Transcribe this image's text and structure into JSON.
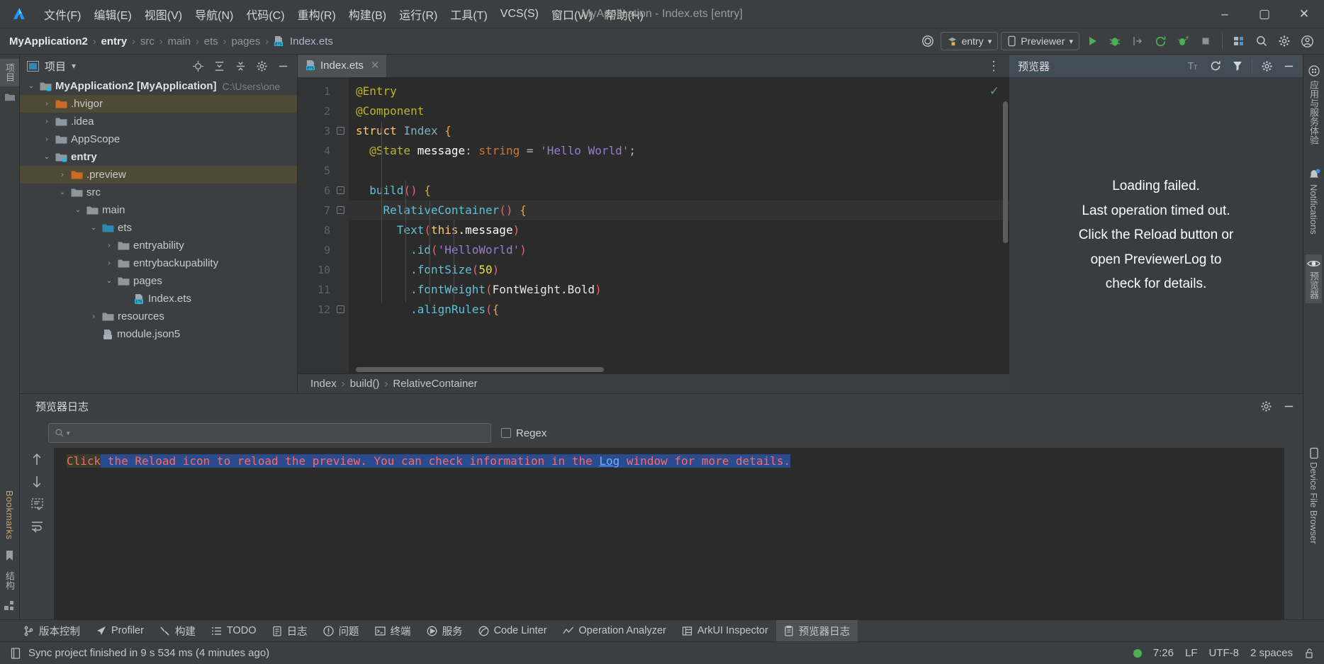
{
  "titlebar": {
    "app_logo": "deveco-logo-icon",
    "menus": [
      {
        "label": "文件(F)",
        "name": "menu-file"
      },
      {
        "label": "编辑(E)",
        "name": "menu-edit"
      },
      {
        "label": "视图(V)",
        "name": "menu-view"
      },
      {
        "label": "导航(N)",
        "name": "menu-navigate"
      },
      {
        "label": "代码(C)",
        "name": "menu-code"
      },
      {
        "label": "重构(R)",
        "name": "menu-refactor"
      },
      {
        "label": "构建(B)",
        "name": "menu-build"
      },
      {
        "label": "运行(R)",
        "name": "menu-run"
      },
      {
        "label": "工具(T)",
        "name": "menu-tools"
      },
      {
        "label": "VCS(S)",
        "name": "menu-vcs"
      },
      {
        "label": "窗口(W)",
        "name": "menu-window"
      },
      {
        "label": "帮助(H)",
        "name": "menu-help"
      }
    ],
    "window_title": "MyApplication - Index.ets [entry]",
    "minimize": "–",
    "maximize": "▢",
    "close": "✕"
  },
  "navbar": {
    "breadcrumbs": [
      "MyApplication2",
      "entry",
      "src",
      "main",
      "ets",
      "pages",
      "Index.ets"
    ],
    "separator": "›",
    "run_config": "entry",
    "device_target": "Previewer",
    "dropdown_caret": "▾",
    "buttons": {
      "device_manager": "device-manager-icon",
      "run": "run-icon",
      "debug": "debug-icon",
      "attach": "attach-debugger-icon",
      "reload": "hot-reload-icon",
      "profile": "profile-icon",
      "stop": "stop-icon",
      "project_structure": "project-structure-icon",
      "search": "search-everywhere-icon",
      "settings": "settings-icon",
      "account": "account-icon"
    }
  },
  "left_strip": {
    "tabs": [
      {
        "label": "项目",
        "name": "left-tab-project",
        "active": true
      },
      {
        "label": "",
        "name": "left-tab-folder-icon",
        "active": false
      }
    ],
    "bottom_tabs": [
      {
        "label": "Bookmarks",
        "name": "left-tab-bookmarks"
      },
      {
        "label": "结构",
        "name": "left-tab-structure"
      }
    ]
  },
  "project_panel": {
    "title": "项目",
    "title_caret": "▾",
    "header_buttons": [
      "select-opened-file-icon",
      "expand-all-icon",
      "collapse-all-icon",
      "settings-icon",
      "hide-icon"
    ],
    "tree": [
      {
        "indent": 0,
        "arrow": "v",
        "icon": "module-folder",
        "label": "MyApplication2 [MyApplication]",
        "bold": true,
        "path": "C:\\Users\\one",
        "state": "normal"
      },
      {
        "indent": 1,
        "arrow": ">",
        "icon": "excluded-folder",
        "label": ".hvigor",
        "bold": false,
        "path": "",
        "state": "highlight"
      },
      {
        "indent": 1,
        "arrow": ">",
        "icon": "folder",
        "label": ".idea",
        "bold": false,
        "path": "",
        "state": "normal"
      },
      {
        "indent": 1,
        "arrow": ">",
        "icon": "folder",
        "label": "AppScope",
        "bold": false,
        "path": "",
        "state": "normal"
      },
      {
        "indent": 1,
        "arrow": "v",
        "icon": "module-folder",
        "label": "entry",
        "bold": true,
        "path": "",
        "state": "normal"
      },
      {
        "indent": 2,
        "arrow": ">",
        "icon": "excluded-folder",
        "label": ".preview",
        "bold": false,
        "path": "",
        "state": "highlight"
      },
      {
        "indent": 2,
        "arrow": "v",
        "icon": "folder",
        "label": "src",
        "bold": false,
        "path": "",
        "state": "normal"
      },
      {
        "indent": 3,
        "arrow": "v",
        "icon": "folder",
        "label": "main",
        "bold": false,
        "path": "",
        "state": "normal"
      },
      {
        "indent": 4,
        "arrow": "v",
        "icon": "source-folder",
        "label": "ets",
        "bold": false,
        "path": "",
        "state": "normal"
      },
      {
        "indent": 5,
        "arrow": ">",
        "icon": "folder",
        "label": "entryability",
        "bold": false,
        "path": "",
        "state": "normal"
      },
      {
        "indent": 5,
        "arrow": ">",
        "icon": "folder",
        "label": "entrybackupability",
        "bold": false,
        "path": "",
        "state": "normal"
      },
      {
        "indent": 5,
        "arrow": "v",
        "icon": "folder",
        "label": "pages",
        "bold": false,
        "path": "",
        "state": "normal"
      },
      {
        "indent": 6,
        "arrow": "",
        "icon": "ets-file",
        "label": "Index.ets",
        "bold": false,
        "path": "",
        "state": "normal"
      },
      {
        "indent": 4,
        "arrow": ">",
        "icon": "folder",
        "label": "resources",
        "bold": false,
        "path": "",
        "state": "normal"
      },
      {
        "indent": 4,
        "arrow": "",
        "icon": "json-file",
        "label": "module.json5",
        "bold": false,
        "path": "",
        "state": "normal"
      }
    ]
  },
  "editor": {
    "tab": {
      "label": "Index.ets",
      "icon": "ets-file-icon",
      "close": "✕"
    },
    "more_button": "⋮",
    "inspection_status": "✓",
    "lines": [
      {
        "n": "1",
        "fold": "",
        "tokens": [
          {
            "t": "@Entry",
            "c": "deco"
          }
        ]
      },
      {
        "n": "2",
        "fold": "",
        "tokens": [
          {
            "t": "@Component",
            "c": "deco"
          }
        ]
      },
      {
        "n": "3",
        "fold": "-",
        "tokens": [
          {
            "t": "struct",
            "c": "kwb"
          },
          {
            "t": " ",
            "c": "plain"
          },
          {
            "t": "Index",
            "c": "teal"
          },
          {
            "t": " ",
            "c": "plain"
          },
          {
            "t": "{",
            "c": "brace"
          }
        ]
      },
      {
        "n": "4",
        "fold": "",
        "tokens": [
          {
            "t": "  ",
            "c": "plain"
          },
          {
            "t": "@State",
            "c": "deco"
          },
          {
            "t": " ",
            "c": "plain"
          },
          {
            "t": "message",
            "c": "wh"
          },
          {
            "t": ":",
            "c": "plain"
          },
          {
            "t": " ",
            "c": "plain"
          },
          {
            "t": "string",
            "c": "kw"
          },
          {
            "t": " ",
            "c": "plain"
          },
          {
            "t": "=",
            "c": "plain"
          },
          {
            "t": " ",
            "c": "plain"
          },
          {
            "t": "'Hello World'",
            "c": "purp"
          },
          {
            "t": ";",
            "c": "plain"
          }
        ]
      },
      {
        "n": "5",
        "fold": "",
        "tokens": []
      },
      {
        "n": "6",
        "fold": "-",
        "tokens": [
          {
            "t": "  ",
            "c": "plain"
          },
          {
            "t": "build",
            "c": "cyan"
          },
          {
            "t": "()",
            "c": "paren"
          },
          {
            "t": " ",
            "c": "plain"
          },
          {
            "t": "{",
            "c": "brace"
          }
        ]
      },
      {
        "n": "7",
        "fold": "-",
        "tokens": [
          {
            "t": "    ",
            "c": "plain"
          },
          {
            "t": "RelativeContainer",
            "c": "cyan"
          },
          {
            "t": "()",
            "c": "paren"
          },
          {
            "t": " ",
            "c": "plain"
          },
          {
            "t": "{",
            "c": "brace"
          }
        ]
      },
      {
        "n": "8",
        "fold": "",
        "tokens": [
          {
            "t": "      ",
            "c": "plain"
          },
          {
            "t": "Text",
            "c": "cyan"
          },
          {
            "t": "(",
            "c": "paren"
          },
          {
            "t": "this",
            "c": "kwb"
          },
          {
            "t": ".",
            "c": "wh"
          },
          {
            "t": "message",
            "c": "wh"
          },
          {
            "t": ")",
            "c": "paren"
          }
        ]
      },
      {
        "n": "9",
        "fold": "",
        "tokens": [
          {
            "t": "        ",
            "c": "plain"
          },
          {
            "t": ".",
            "c": "cyan"
          },
          {
            "t": "id",
            "c": "cyan"
          },
          {
            "t": "(",
            "c": "paren"
          },
          {
            "t": "'HelloWorld'",
            "c": "purp"
          },
          {
            "t": ")",
            "c": "paren"
          }
        ]
      },
      {
        "n": "10",
        "fold": "",
        "tokens": [
          {
            "t": "        ",
            "c": "plain"
          },
          {
            "t": ".",
            "c": "cyan"
          },
          {
            "t": "fontSize",
            "c": "cyan"
          },
          {
            "t": "(",
            "c": "paren"
          },
          {
            "t": "50",
            "c": "yel"
          },
          {
            "t": ")",
            "c": "paren"
          }
        ]
      },
      {
        "n": "11",
        "fold": "",
        "tokens": [
          {
            "t": "        ",
            "c": "plain"
          },
          {
            "t": ".",
            "c": "cyan"
          },
          {
            "t": "fontWeight",
            "c": "cyan"
          },
          {
            "t": "(",
            "c": "paren"
          },
          {
            "t": "FontWeight",
            "c": "white"
          },
          {
            "t": ".",
            "c": "white"
          },
          {
            "t": "Bold",
            "c": "white"
          },
          {
            "t": ")",
            "c": "paren"
          }
        ]
      },
      {
        "n": "12",
        "fold": "-",
        "tokens": [
          {
            "t": "        ",
            "c": "plain"
          },
          {
            "t": ".",
            "c": "cyan"
          },
          {
            "t": "alignRules",
            "c": "cyan"
          },
          {
            "t": "(",
            "c": "paren"
          },
          {
            "t": "{",
            "c": "brace"
          }
        ]
      }
    ],
    "breadcrumb": [
      "Index",
      "build()",
      "RelativeContainer"
    ],
    "breadcrumb_sep": "›"
  },
  "previewer": {
    "title": "预览器",
    "header_buttons": [
      "text-scale-icon",
      "reload-icon",
      "inspector-icon",
      "settings-icon",
      "hide-icon"
    ],
    "message_lines": [
      "Loading failed.",
      "Last operation timed out.",
      "Click the Reload button or",
      "open PreviewerLog to",
      "check for details."
    ]
  },
  "right_strip": {
    "tabs": [
      {
        "label": "应用与服务体验",
        "name": "right-tab-app-services",
        "icon": "app-services-icon",
        "active": false
      },
      {
        "label": "Notifications",
        "name": "right-tab-notifications",
        "icon": "bell-icon",
        "active": false
      },
      {
        "label": "预览器",
        "name": "right-tab-previewer",
        "icon": "eye-icon",
        "active": true
      },
      {
        "label": "Device File Browser",
        "name": "right-tab-device-file-browser",
        "icon": "device-icon",
        "active": false
      }
    ]
  },
  "log_panel": {
    "title": "预览器日志",
    "header_buttons": [
      "settings-icon",
      "hide-icon"
    ],
    "search_placeholder": "",
    "search_value": "",
    "search_icon": "search-icon",
    "regex_label": "Regex",
    "regex_checked": false,
    "side_buttons": [
      "scroll-up-icon",
      "scroll-down-icon",
      "soft-wrap-icon",
      "wrap-lines-icon"
    ],
    "log_line": {
      "prefix": "Click",
      "body": " the Reload icon to reload the preview. You can check information in the ",
      "link": "Log",
      "suffix": " window for more details."
    }
  },
  "tool_window_bar": {
    "items": [
      {
        "label": "版本控制",
        "name": "tw-version-control",
        "icon": "branch-icon",
        "active": false
      },
      {
        "label": "Profiler",
        "name": "tw-profiler",
        "icon": "profiler-icon",
        "active": false
      },
      {
        "label": "构建",
        "name": "tw-build",
        "icon": "hammer-icon",
        "active": false
      },
      {
        "label": "TODO",
        "name": "tw-todo",
        "icon": "list-icon",
        "active": false
      },
      {
        "label": "日志",
        "name": "tw-log",
        "icon": "log-icon",
        "active": false
      },
      {
        "label": "问题",
        "name": "tw-problems",
        "icon": "problems-icon",
        "active": false
      },
      {
        "label": "终端",
        "name": "tw-terminal",
        "icon": "terminal-icon",
        "active": false
      },
      {
        "label": "服务",
        "name": "tw-services",
        "icon": "services-icon",
        "active": false
      },
      {
        "label": "Code Linter",
        "name": "tw-code-linter",
        "icon": "linter-icon",
        "active": false
      },
      {
        "label": "Operation Analyzer",
        "name": "tw-operation-analyzer",
        "icon": "analyzer-icon",
        "active": false
      },
      {
        "label": "ArkUI Inspector",
        "name": "tw-arkui-inspector",
        "icon": "inspector-icon",
        "active": false
      },
      {
        "label": "预览器日志",
        "name": "tw-previewer-log",
        "icon": "previewer-log-icon",
        "active": true
      }
    ]
  },
  "statusbar": {
    "icon": "memory-icon",
    "message": "Sync project finished in 9 s 534 ms (4 minutes ago)",
    "indicator_color": "#4caf50",
    "position": "7:26",
    "line_sep": "LF",
    "encoding": "UTF-8",
    "indent": "2 spaces",
    "lock": "lock-icon"
  }
}
